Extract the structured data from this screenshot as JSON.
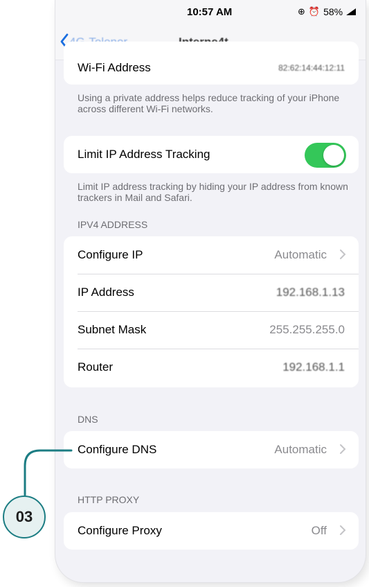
{
  "status_bar": {
    "time": "10:57 AM",
    "battery": "58%"
  },
  "nav": {
    "back_label": "4G-Telenor",
    "title": "Interne4t"
  },
  "wifi_address": {
    "label": "Wi-Fi Address",
    "value": "82:62:14:44:12:11"
  },
  "private_address_note": "Using a private address helps reduce tracking of your iPhone across different Wi-Fi networks.",
  "limit_ip": {
    "label": "Limit IP Address Tracking",
    "enabled": true,
    "note": "Limit IP address tracking by hiding your IP address from known trackers in Mail and Safari."
  },
  "ipv4": {
    "header": "IPV4 ADDRESS",
    "configure_ip": {
      "label": "Configure IP",
      "value": "Automatic"
    },
    "ip_address": {
      "label": "IP Address",
      "value": "192.168.1.13"
    },
    "subnet_mask": {
      "label": "Subnet Mask",
      "value": "255.255.255.0"
    },
    "router": {
      "label": "Router",
      "value": "192.168.1.1"
    }
  },
  "dns": {
    "header": "DNS",
    "configure_dns": {
      "label": "Configure DNS",
      "value": "Automatic"
    }
  },
  "http_proxy": {
    "header": "HTTP PROXY",
    "configure_proxy": {
      "label": "Configure Proxy",
      "value": "Off"
    }
  },
  "callout": {
    "step": "03",
    "color": "#1c7d83"
  },
  "colors": {
    "toggle_on": "#34c759",
    "link_blue": "#8fb2e8",
    "grouped_background": "#f2f2f7"
  }
}
